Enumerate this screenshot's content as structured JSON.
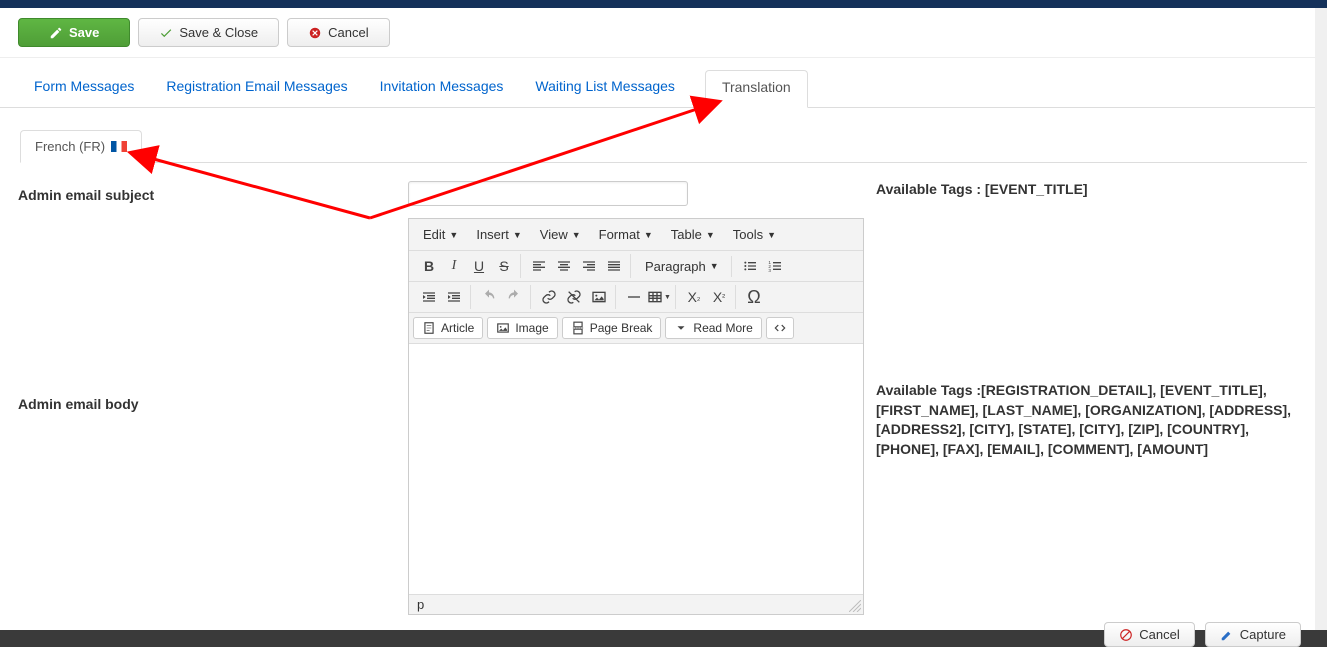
{
  "buttons": {
    "save": "Save",
    "save_close": "Save & Close",
    "cancel": "Cancel",
    "capture": "Capture"
  },
  "main_tabs": [
    {
      "label": "Form Messages",
      "active": false
    },
    {
      "label": "Registration Email Messages",
      "active": false
    },
    {
      "label": "Invitation Messages",
      "active": false
    },
    {
      "label": "Waiting List Messages",
      "active": false
    },
    {
      "label": "Translation",
      "active": true
    }
  ],
  "lang_tab": {
    "label": "French (FR)"
  },
  "fields": {
    "subject_label": "Admin email subject",
    "body_label": "Admin email body"
  },
  "subject_tags": "Available Tags : [EVENT_TITLE]",
  "body_tags": "Available Tags :[REGISTRATION_DETAIL], [EVENT_TITLE], [FIRST_NAME], [LAST_NAME], [ORGANIZATION], [ADDRESS], [ADDRESS2], [CITY], [STATE], [CITY], [ZIP], [COUNTRY], [PHONE], [FAX], [EMAIL], [COMMENT], [AMOUNT]",
  "editor": {
    "menus": [
      "Edit",
      "Insert",
      "View",
      "Format",
      "Table",
      "Tools"
    ],
    "paragraph": "Paragraph",
    "btns": {
      "article": "Article",
      "image": "Image",
      "pagebreak": "Page Break",
      "readmore": "Read More"
    },
    "status": "p"
  }
}
